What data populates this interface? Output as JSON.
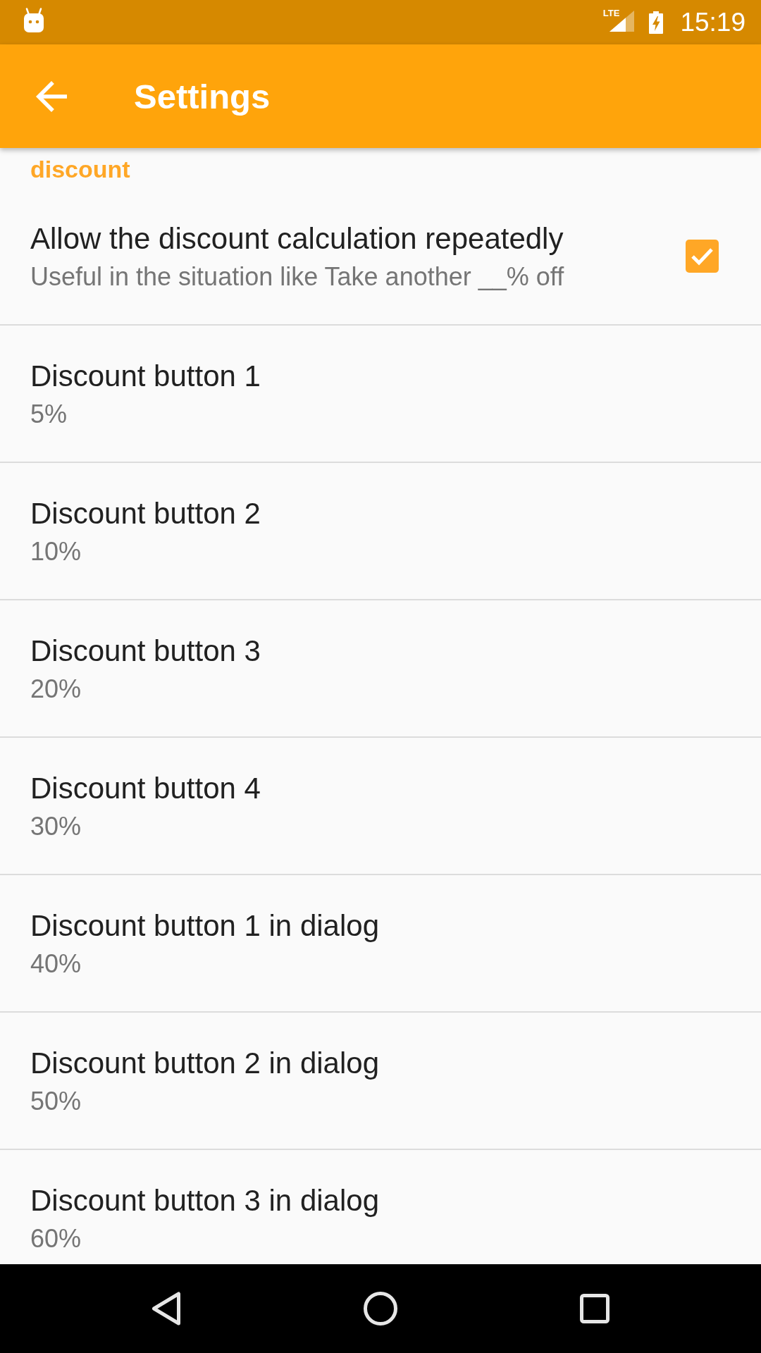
{
  "status_bar": {
    "network": "LTE",
    "time": "15:19"
  },
  "app_bar": {
    "title": "Settings"
  },
  "category": {
    "title": "discount",
    "preferences": [
      {
        "kind": "checkbox",
        "title": "Allow the discount calculation repeatedly",
        "summary": "Useful in the situation like Take another __% off",
        "checked": true
      },
      {
        "kind": "text",
        "title": "Discount button 1",
        "summary": "5%"
      },
      {
        "kind": "text",
        "title": "Discount button 2",
        "summary": "10%"
      },
      {
        "kind": "text",
        "title": "Discount button 3",
        "summary": "20%"
      },
      {
        "kind": "text",
        "title": "Discount button 4",
        "summary": "30%"
      },
      {
        "kind": "text",
        "title": "Discount button 1 in dialog",
        "summary": "40%"
      },
      {
        "kind": "text",
        "title": "Discount button 2 in dialog",
        "summary": "50%"
      },
      {
        "kind": "text",
        "title": "Discount button 3 in dialog",
        "summary": "60%"
      }
    ]
  }
}
